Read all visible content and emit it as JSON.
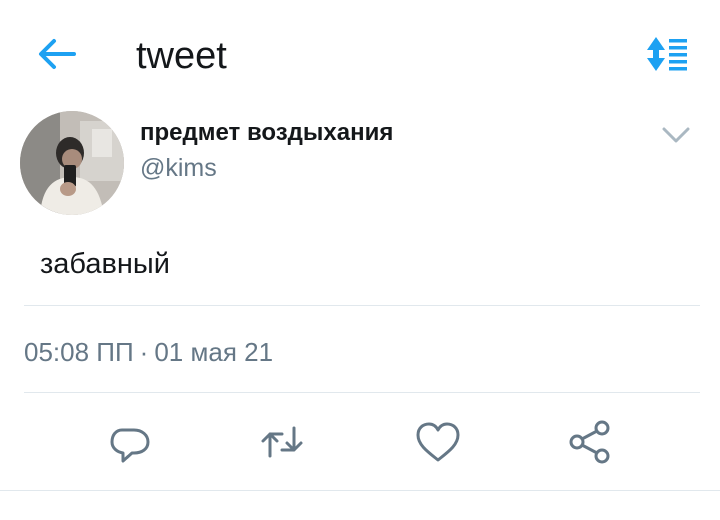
{
  "header": {
    "title": "tweet",
    "back_icon": "arrow-left-icon",
    "sort_icon": "sort-list-icon"
  },
  "tweet": {
    "display_name": "предмет воздыхания",
    "handle": "@kims",
    "text": "забавный",
    "time": "05:08 ПП",
    "separator": "·",
    "date": "01 мая 21"
  },
  "actions": {
    "reply_icon": "reply-icon",
    "retweet_icon": "retweet-icon",
    "like_icon": "heart-icon",
    "share_icon": "share-icon"
  },
  "colors": {
    "accent": "#1da1f2",
    "text_primary": "#14171a",
    "text_secondary": "#657786",
    "icon_gray": "#657786",
    "divider": "#e1e8ed"
  }
}
